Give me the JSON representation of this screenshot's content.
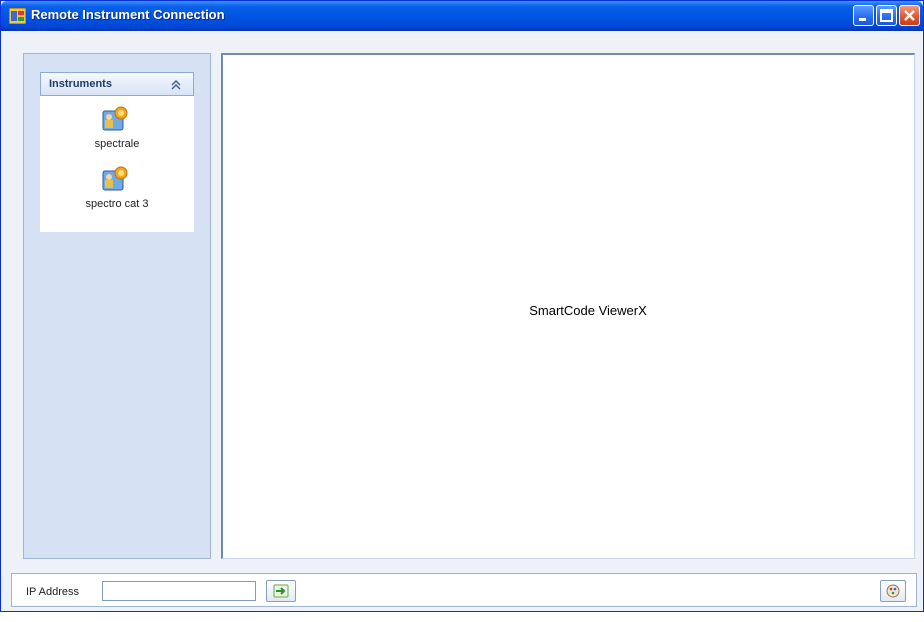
{
  "window": {
    "title": "Remote Instrument Connection",
    "accent": "#0055e5",
    "icons": {
      "app": "app-icon",
      "minimize": "minimize-icon",
      "maximize": "maximize-icon",
      "close": "close-icon"
    }
  },
  "sidebar": {
    "panel_title": "Instruments",
    "collapse_icon": "chevron-up-double-icon",
    "items": [
      {
        "label": "spectrale",
        "icon": "instrument-icon"
      },
      {
        "label": "spectro cat 3",
        "icon": "instrument-icon"
      }
    ]
  },
  "viewer": {
    "label": "SmartCode ViewerX"
  },
  "bottom": {
    "ip_label": "IP Address",
    "ip_value": "",
    "ip_placeholder": "",
    "go_icon": "arrow-right-icon",
    "settings_icon": "palette-icon"
  }
}
